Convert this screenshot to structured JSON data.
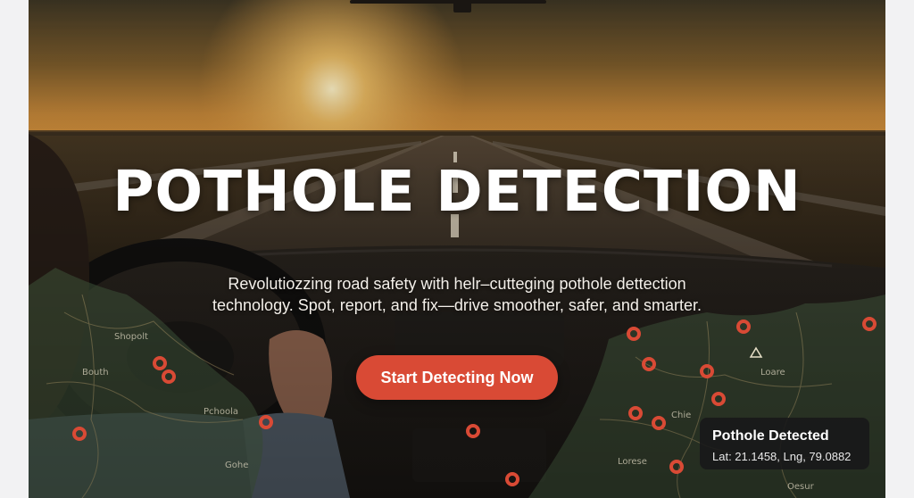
{
  "hero": {
    "title": "POTHOLE DETECTION",
    "subtitle_line1": "Revolutiozzing road safety with helr–cutteging pothole dettection",
    "subtitle_line2": "technology. Spot, report, and fix—drive smoother, safer, and smarter.",
    "cta_label": "Start Detecting Now"
  },
  "map": {
    "marker_color": "#d94a35",
    "marker_icon": "pothole-marker-icon",
    "labels": [
      "Shopolt",
      "Bouth",
      "Pchoola",
      "Gohe",
      "Chie",
      "Lorese",
      "Loare",
      "Oesur"
    ]
  },
  "detection_card": {
    "title": "Pothole Detected",
    "coords": "Lat: 21.1458, Lng, 79.0882"
  },
  "colors": {
    "accent": "#d94a35",
    "page_background": "#f2f2f3",
    "card_background": "#18181a"
  }
}
